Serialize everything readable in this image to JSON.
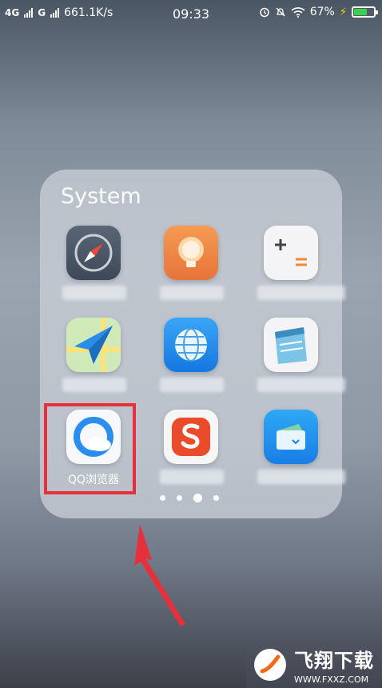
{
  "statusbar": {
    "network_1": "4G",
    "network_2": "G",
    "speed": "661.1K/s",
    "time": "09:33",
    "battery": "67%",
    "battery_level": 0.67
  },
  "folder": {
    "title": "System",
    "apps": [
      {
        "icon": "compass-icon"
      },
      {
        "icon": "lightbulb-icon"
      },
      {
        "icon": "calculator-icon"
      },
      {
        "icon": "maps-icon"
      },
      {
        "icon": "browser-globe-icon"
      },
      {
        "icon": "notepad-icon"
      },
      {
        "icon": "qq-browser-icon",
        "label": "QQ浏览器"
      },
      {
        "icon": "sogou-icon"
      },
      {
        "icon": "wallet-icon"
      }
    ],
    "page_count": 4,
    "active_page": 3
  },
  "colors": {
    "highlight": "#e8303a",
    "arrow": "#e8303a"
  },
  "watermark": {
    "text": "飞翔下载",
    "url": "WWW.FXXZ.COM"
  }
}
